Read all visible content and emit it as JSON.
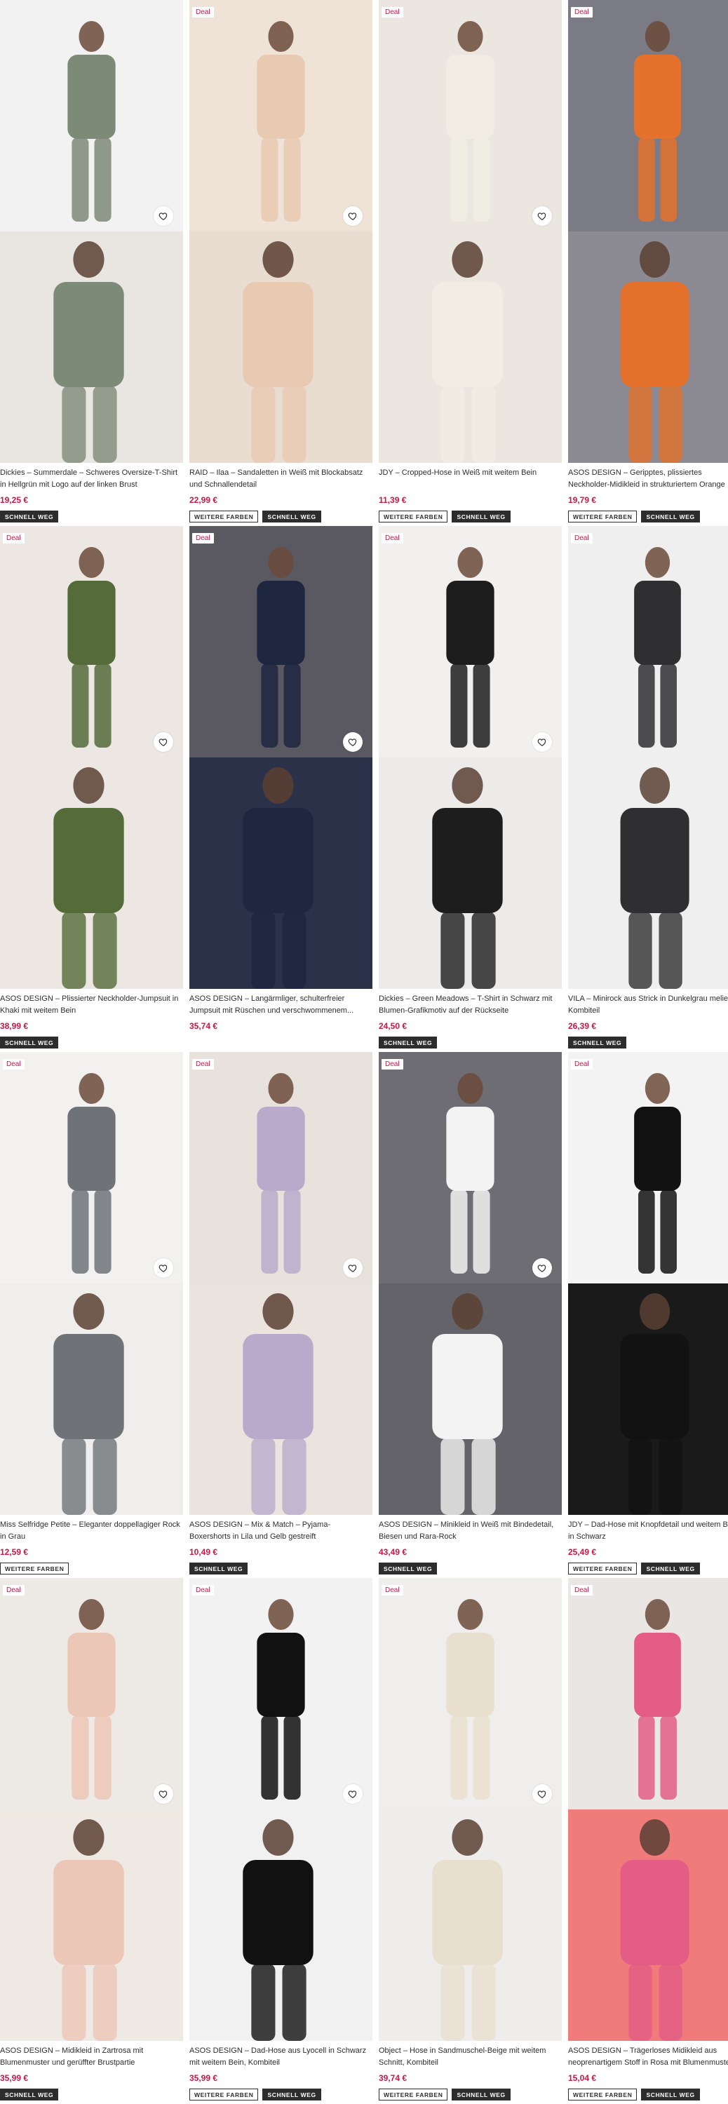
{
  "labels": {
    "deal": "Deal",
    "more_colors": "WEITERE FARBEN",
    "fast": "SCHNELL WEG"
  },
  "colors": {
    "accent_price": "#d01345",
    "badge_dark": "#2d2d2d"
  },
  "products": [
    {
      "title": "Dickies – Summerdale – Schweres Oversize-T-Shirt in Hellgrün mit Logo auf der linken Brust",
      "price": "19,25 €",
      "deal": false,
      "heart": true,
      "badges": [
        "fast"
      ],
      "palette": [
        "#f2f2f2",
        "#7e8a78",
        "#e9e6e2"
      ]
    },
    {
      "title": "RAID – Ilaa – Sandaletten in Weiß mit Blockabsatz und Schnallendetail",
      "price": "22,99 €",
      "deal": true,
      "heart": true,
      "badges": [
        "more_colors",
        "fast"
      ],
      "palette": [
        "#efe3d8",
        "#e8c9b1",
        "#e9ddd2"
      ]
    },
    {
      "title": "JDY – Cropped-Hose in Weiß mit weitem Bein",
      "price": "11,39 €",
      "deal": true,
      "heart": true,
      "badges": [
        "more_colors",
        "fast"
      ],
      "palette": [
        "#ebe6df",
        "#f1ede4",
        "#ebe6df"
      ]
    },
    {
      "title": "ASOS DESIGN – Geripptes, plissiertes Neckholder-Midikleid in strukturiertem Orange",
      "price": "19,79 €",
      "deal": true,
      "heart": false,
      "badges": [
        "more_colors",
        "fast"
      ],
      "palette": [
        "#7b7b85",
        "#e4722c",
        "#8c8a93"
      ]
    },
    {
      "title": "ASOS DESIGN – Plissierter Neckholder-Jumpsuit in Khaki mit weitem Bein",
      "price": "38,99 €",
      "deal": true,
      "heart": true,
      "badges": [
        "fast"
      ],
      "palette": [
        "#ece7e2",
        "#556b3a",
        "#ece7e2"
      ]
    },
    {
      "title": "ASOS DESIGN – Langärmliger, schulterfreier Jumpsuit mit Rüschen und verschwommenem...",
      "price": "35,74 €",
      "deal": true,
      "heart": true,
      "badges": [],
      "palette": [
        "#5a5860",
        "#1f2640",
        "#2b3148"
      ]
    },
    {
      "title": "Dickies – Green Meadows – T-Shirt in Schwarz mit Blumen-Grafikmotiv auf der Rückseite",
      "price": "24,50 €",
      "deal": true,
      "heart": true,
      "badges": [
        "fast"
      ],
      "palette": [
        "#f1f0ef",
        "#1d1d1d",
        "#ecebea"
      ]
    },
    {
      "title": "VILA – Minirock aus Strick in Dunkelgrau meliert, Kombiteil",
      "price": "26,39 €",
      "deal": true,
      "heart": false,
      "badges": [
        "fast"
      ],
      "palette": [
        "#f0efef",
        "#2f2f31",
        "#f0efef"
      ]
    },
    {
      "title": "Miss Selfridge Petite – Eleganter doppellagiger Rock in Grau",
      "price": "12,59 €",
      "deal": true,
      "heart": true,
      "badges": [
        "more_colors"
      ],
      "palette": [
        "#f2f1ef",
        "#6f7378",
        "#efeeec"
      ]
    },
    {
      "title": "ASOS DESIGN – Mix & Match – Pyjama-Boxershorts in Lila und Gelb gestreift",
      "price": "10,49 €",
      "deal": true,
      "heart": true,
      "badges": [
        "fast"
      ],
      "palette": [
        "#e8e2dd",
        "#b9aacb",
        "#ebe4de"
      ]
    },
    {
      "title": "ASOS DESIGN – Minikleid in Weiß mit Bindedetail, Biesen und Rara-Rock",
      "price": "43,49 €",
      "deal": true,
      "heart": true,
      "badges": [
        "fast"
      ],
      "palette": [
        "#6e6d73",
        "#f3f3f3",
        "#64636a"
      ]
    },
    {
      "title": "JDY – Dad-Hose mit Knopfdetail und weitem Bein in Schwarz",
      "price": "25,49 €",
      "deal": true,
      "heart": false,
      "badges": [
        "more_colors",
        "fast"
      ],
      "palette": [
        "#f3f3f3",
        "#121212",
        "#1a1a1a"
      ]
    },
    {
      "title": "ASOS DESIGN – Midikleid in Zartrosa mit Blumenmuster und gerüffter Brustpartie",
      "price": "35,99 €",
      "deal": true,
      "heart": true,
      "badges": [
        "fast"
      ],
      "palette": [
        "#ede9e5",
        "#ecc6b6",
        "#efe9e3"
      ]
    },
    {
      "title": "ASOS DESIGN – Dad-Hose aus Lyocell in Schwarz mit weitem Bein, Kombiteil",
      "price": "35,99 €",
      "deal": true,
      "heart": true,
      "badges": [
        "more_colors",
        "fast"
      ],
      "palette": [
        "#f2f2f2",
        "#111111",
        "#f1f1f1"
      ]
    },
    {
      "title": "Object – Hose in Sandmuschel-Beige mit weitem Schnitt, Kombiteil",
      "price": "39,74 €",
      "deal": true,
      "heart": true,
      "badges": [
        "more_colors",
        "fast"
      ],
      "palette": [
        "#f0eeec",
        "#e9dfcf",
        "#efedeb"
      ]
    },
    {
      "title": "ASOS DESIGN – Trägerloses Midikleid aus neoprenartigem Stoff in Rosa mit Blumenmuster",
      "price": "15,04 €",
      "deal": true,
      "heart": false,
      "badges": [
        "more_colors",
        "fast"
      ],
      "palette": [
        "#eae6e3",
        "#e35d86",
        "#f07b7b"
      ]
    }
  ]
}
